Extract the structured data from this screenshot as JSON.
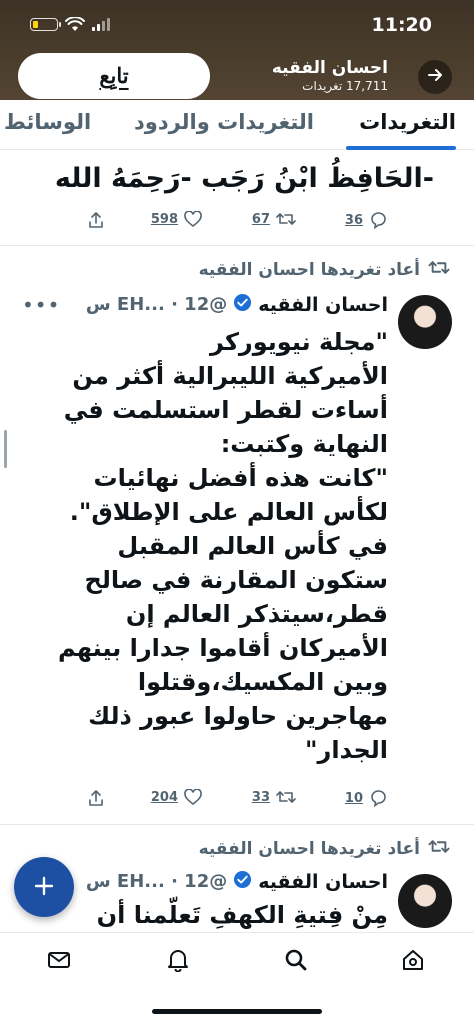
{
  "status_bar": {
    "time": "11:20"
  },
  "header": {
    "follow_label": "تابِع",
    "profile_name": "احسان الفقيه",
    "tweet_count": "17,711 تغريدات"
  },
  "tabs": [
    {
      "label": "التغريدات",
      "active": true
    },
    {
      "label": "التغريدات والردود",
      "active": false
    },
    {
      "label": "الوسائط",
      "active": false
    }
  ],
  "tweets": [
    {
      "text": "-الحَافِظُ ابْنُ رَجَب -رَحِمَهُ الله",
      "replies": "36",
      "retweets": "67",
      "likes": "598"
    },
    {
      "retweeted_by": "أعاد تغريدها احسان الفقيه",
      "author": "احسان الفقيه",
      "handle": "@EH... · 12 س",
      "text": "\"مجلة نيويوركر\nالأميركية الليبرالية أكثر من\nأساءت لقطر استسلمت في\nالنهاية وكتبت:\n\"كانت هذه أفضل نهائيات\nلكأس العالم على الإطلاق\".\nفي كأس العالم المقبل\nستكون المقارنة في صالح\nقطر،سيتذكر العالم إن\nالأميركان أقاموا جدارا بينهم\nوبين المكسيك،وقتلوا\nمهاجرين حاولوا عبور ذلك\nالجدار\"",
      "replies": "10",
      "retweets": "33",
      "likes": "204"
    },
    {
      "retweeted_by": "أعاد تغريدها احسان الفقيه",
      "author": "احسان الفقيه",
      "handle": "@EH... · 12 س",
      "text": "مِنْ فِتيةِ الكهفِ تَعلّمنا أن"
    }
  ],
  "colors": {
    "accent": "#1d6fd6",
    "fab": "#1d4fa3",
    "banner": "#4a3d2c",
    "muted": "#536471"
  },
  "icons": [
    "arrow-right-icon",
    "verified-badge-icon",
    "reply-icon",
    "retweet-icon",
    "like-icon",
    "share-icon",
    "compose-plus-icon",
    "mail-icon",
    "bell-icon",
    "search-icon",
    "home-icon"
  ]
}
